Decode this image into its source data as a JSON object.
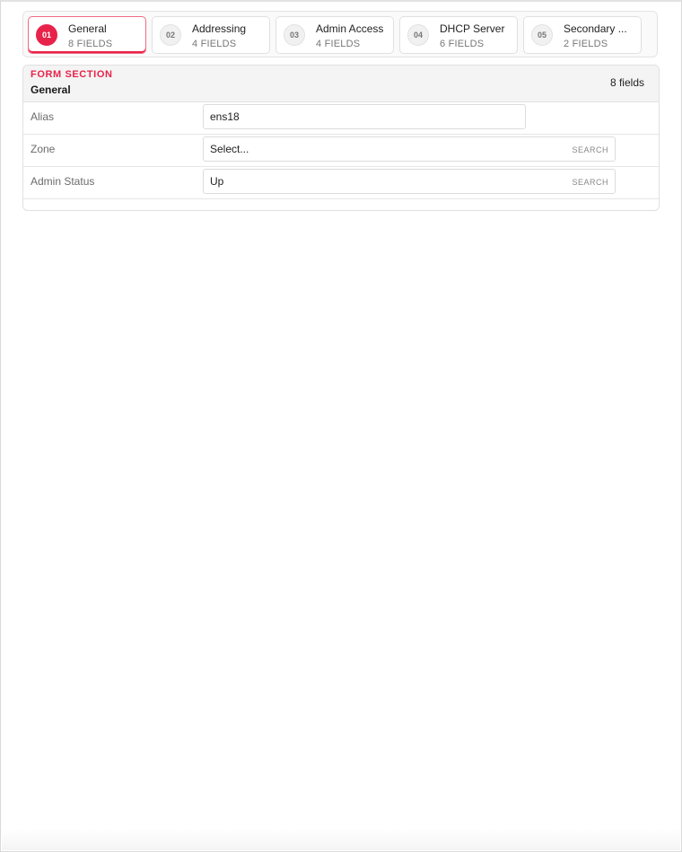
{
  "steps": [
    {
      "num": "01",
      "title": "General",
      "sub": "8 FIELDS",
      "active": true
    },
    {
      "num": "02",
      "title": "Addressing",
      "sub": "4 FIELDS"
    },
    {
      "num": "03",
      "title": "Admin Access",
      "sub": "4 FIELDS"
    },
    {
      "num": "04",
      "title": "DHCP Server",
      "sub": "6 FIELDS"
    },
    {
      "num": "05",
      "title": "Secondary ...",
      "sub": "2 FIELDS"
    }
  ],
  "section": {
    "kicker": "FORM SECTION",
    "title": "General",
    "count": "8 fields"
  },
  "fields": [
    {
      "label": "Alias",
      "value": "ens18",
      "type": "text"
    },
    {
      "label": "Zone",
      "value": "Select...",
      "hint": "SEARCH",
      "type": "select"
    },
    {
      "label": "Admin Status",
      "value": "Up",
      "hint": "SEARCH",
      "type": "select"
    }
  ],
  "colors": {
    "accent": "#e8234a",
    "border": "#e0e0e0",
    "header_bg": "#f4f4f4"
  }
}
